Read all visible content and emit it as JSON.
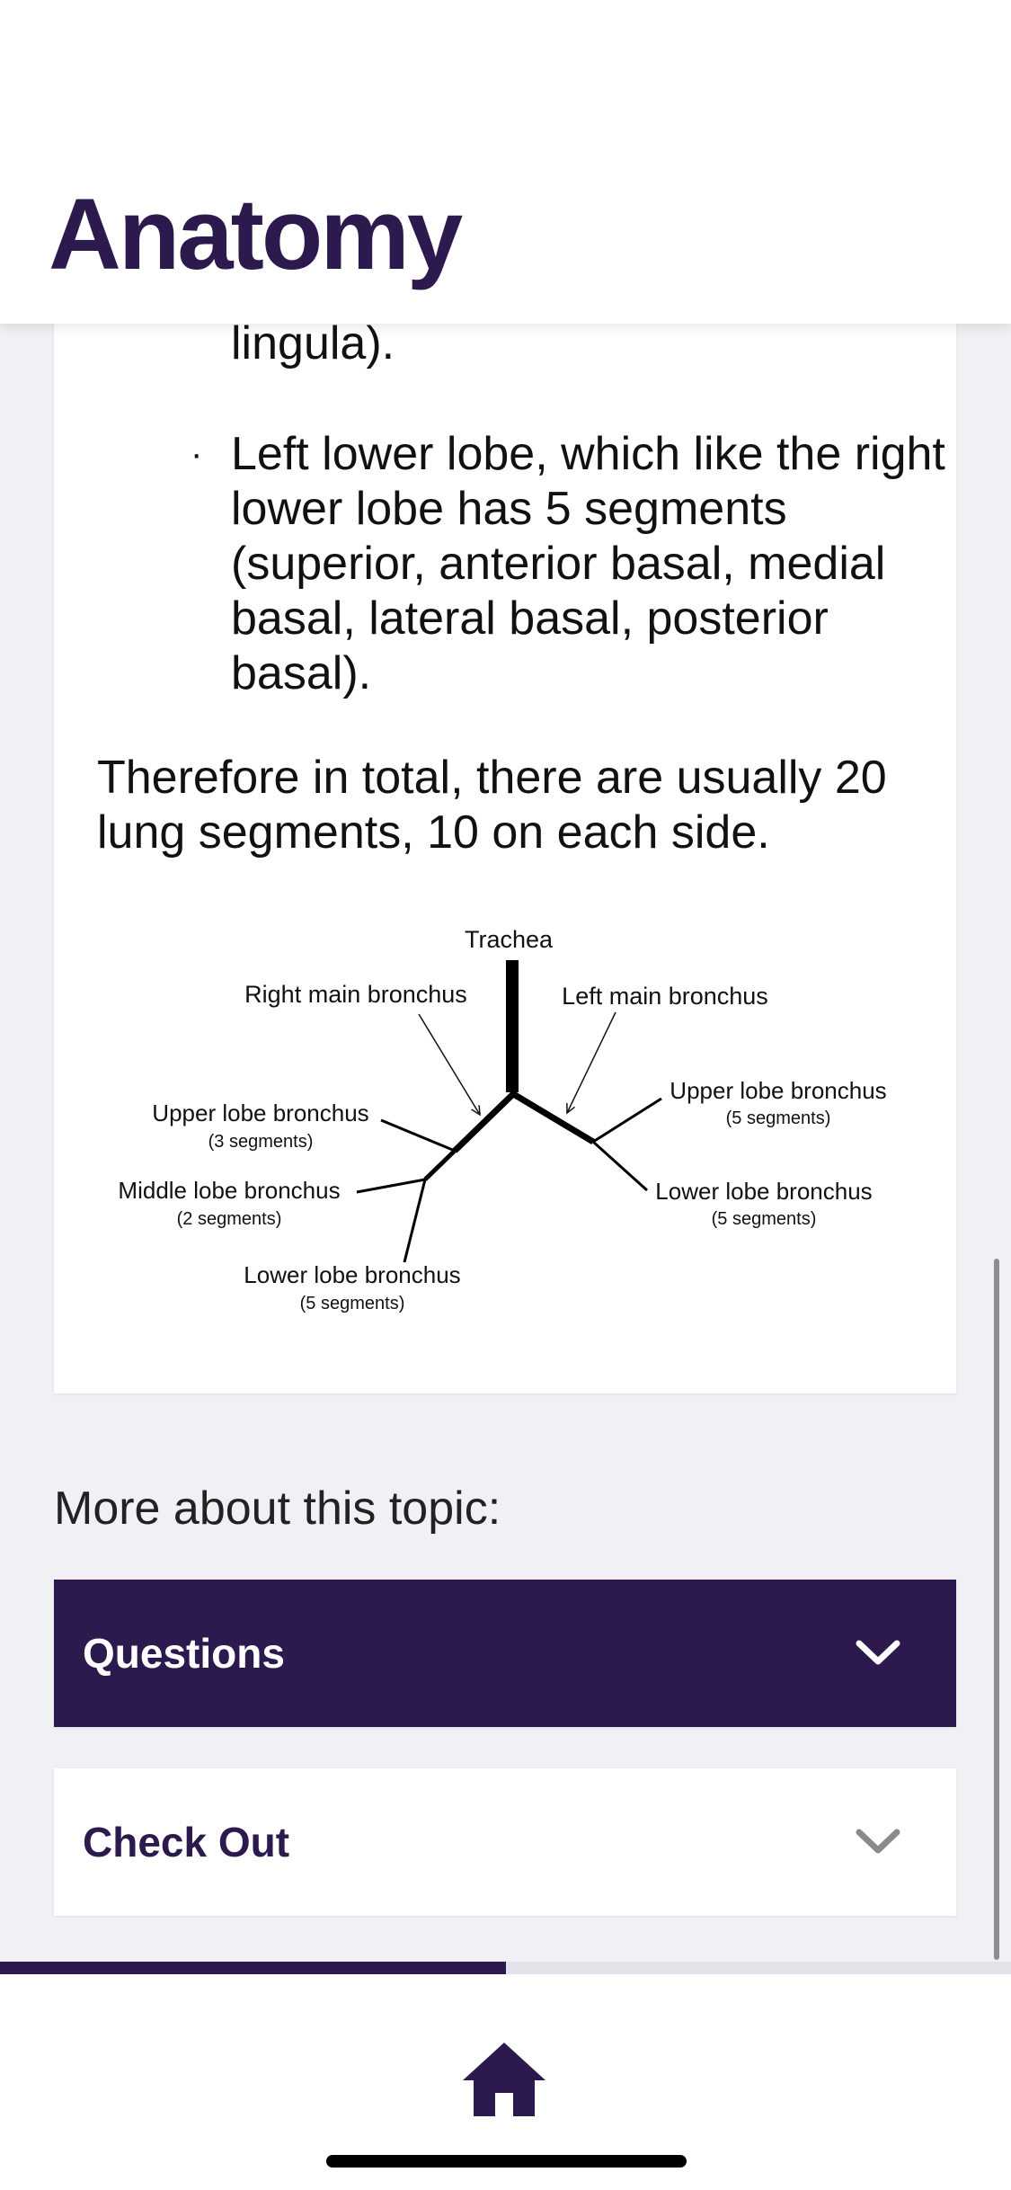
{
  "header": {
    "title": "Anatomy"
  },
  "content": {
    "fragment": "lingula).",
    "bullets": [
      "Left lower lobe, which like the right lower lobe has 5 segments (superior, anterior basal, medial basal, lateral basal, posterior basal)."
    ],
    "bullet_marker": "·",
    "summary": "Therefore in total, there are usually 20 lung segments, 10 on each side."
  },
  "diagram": {
    "trachea": "Trachea",
    "right_main": "Right main bronchus",
    "left_main": "Left main bronchus",
    "r_upper": "Upper lobe bronchus",
    "r_upper_seg": "(3 segments)",
    "r_middle": "Middle lobe bronchus",
    "r_middle_seg": "(2 segments)",
    "r_lower": "Lower lobe bronchus",
    "r_lower_seg": "(5 segments)",
    "l_upper": "Upper lobe bronchus",
    "l_upper_seg": "(5 segments)",
    "l_lower": "Lower lobe bronchus",
    "l_lower_seg": "(5 segments)"
  },
  "more": {
    "heading": "More about this topic:",
    "sections": [
      {
        "label": "Questions",
        "expanded": false
      },
      {
        "label": "Check Out",
        "expanded": false
      }
    ]
  },
  "reading_progress": 0.5,
  "colors": {
    "brand": "#2c1a4f",
    "background": "#f1f0f5",
    "chevron_light": "#8a8a8e"
  },
  "icons": {
    "home": "home-icon",
    "chevron": "chevron-down-icon"
  }
}
